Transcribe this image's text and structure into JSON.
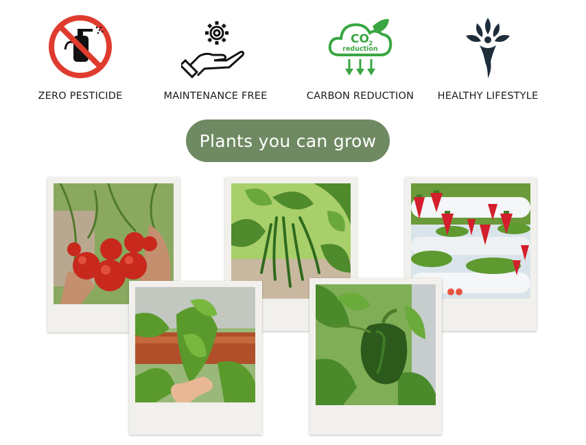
{
  "features": [
    {
      "label": "ZERO PESTICIDE",
      "icon": "no-pesticide-icon"
    },
    {
      "label": "MAINTENANCE FREE",
      "icon": "hand-gear-icon"
    },
    {
      "label": "CARBON REDUCTION",
      "icon": "co2-cloud-icon",
      "icon_text": {
        "main": "CO",
        "sub": "2",
        "caption": "reduction"
      }
    },
    {
      "label": "HEALTHY LIFESTYLE",
      "icon": "leaf-person-icon"
    }
  ],
  "heading": "Plants you can grow",
  "photos": [
    {
      "subject": "tomatoes"
    },
    {
      "subject": "green beans"
    },
    {
      "subject": "strawberries"
    },
    {
      "subject": "spinach"
    },
    {
      "subject": "bell pepper"
    }
  ],
  "colors": {
    "accent": "#6f8a63",
    "no_sign_red": "#e03b2f",
    "co2_green": "#3aa642",
    "polaroid_frame": "#f1f0ec"
  }
}
